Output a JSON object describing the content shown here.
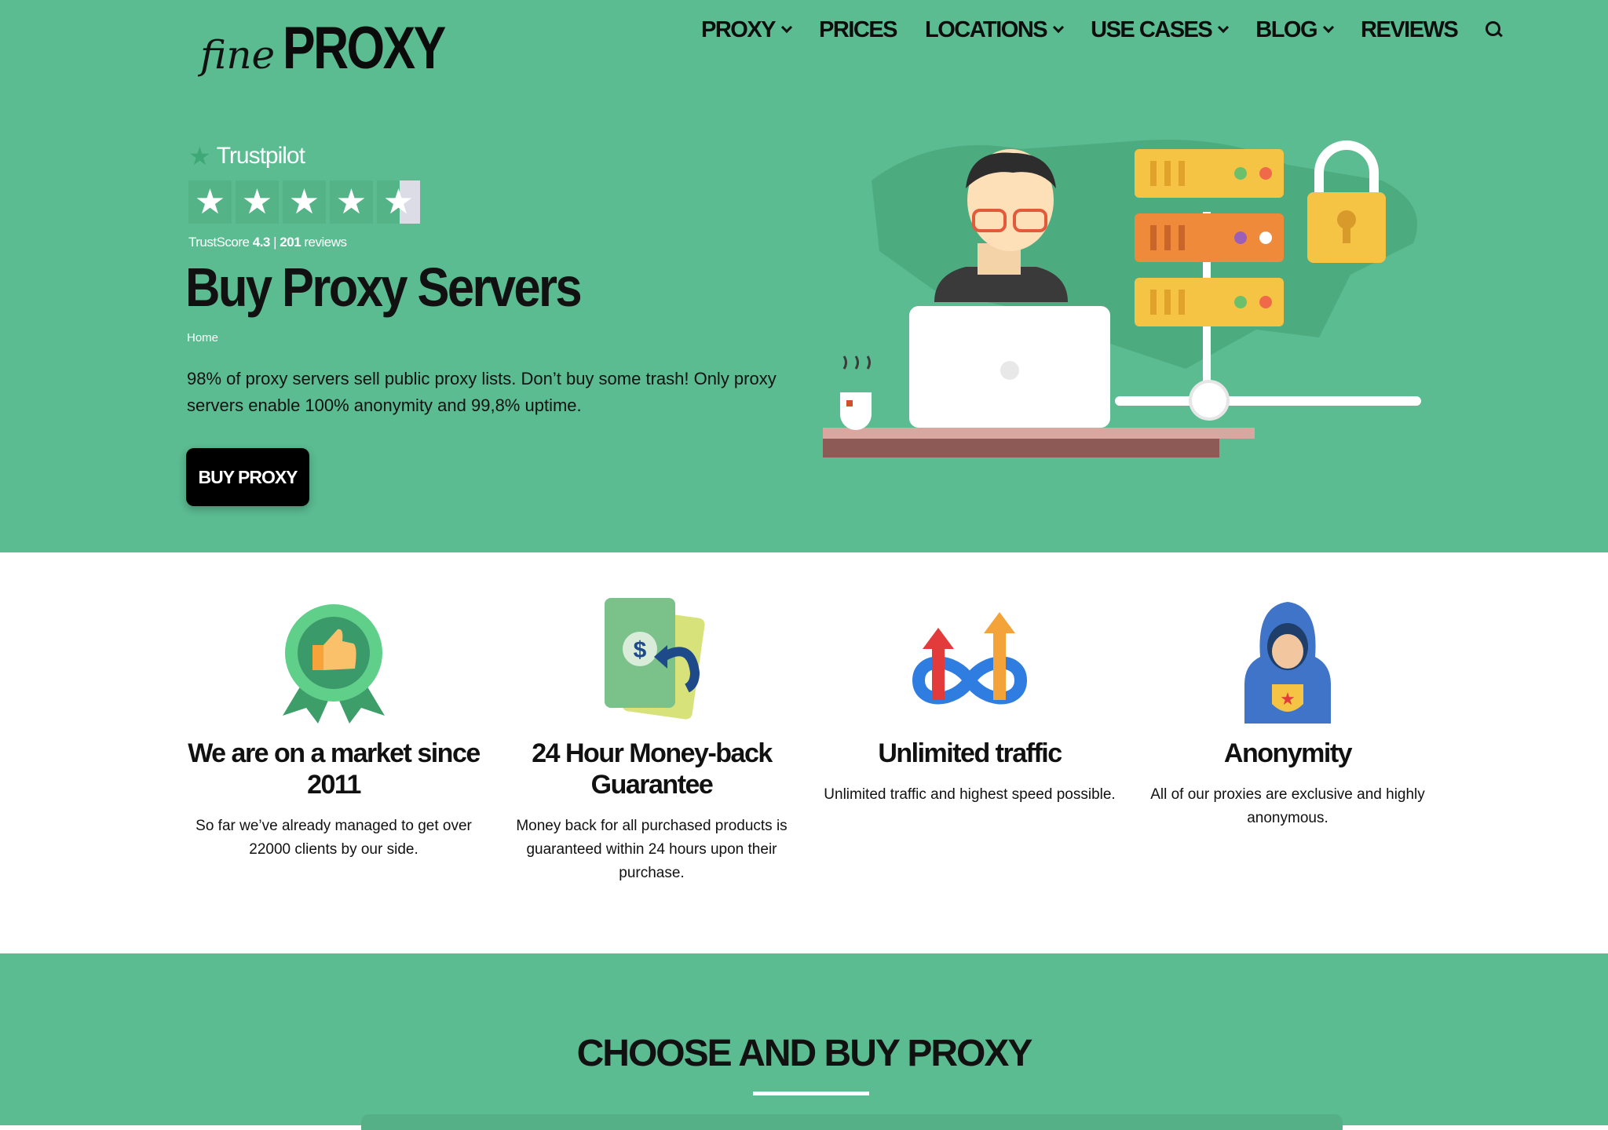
{
  "brand": {
    "fine": "fine",
    "proxy": "PROXY"
  },
  "nav": {
    "items": [
      {
        "label": "PROXY",
        "dropdown": true
      },
      {
        "label": "PRICES",
        "dropdown": false
      },
      {
        "label": "LOCATIONS",
        "dropdown": true
      },
      {
        "label": "USE CASES",
        "dropdown": true
      },
      {
        "label": "BLOG",
        "dropdown": true
      },
      {
        "label": "REVIEWS",
        "dropdown": false
      }
    ],
    "search_icon": "search-icon"
  },
  "trustpilot": {
    "brand": "Trustpilot",
    "score_label": "TrustScore",
    "score": "4.3",
    "separator": "|",
    "reviews_count": "201",
    "reviews_label": "reviews",
    "rating": 4.3
  },
  "hero": {
    "title": "Buy Proxy Servers",
    "breadcrumb": "Home",
    "lead": "98% of proxy servers sell public proxy lists. Don’t buy some trash! Only proxy servers enable 100% anonymity and 99,8% uptime.",
    "cta": "BUY PROXY"
  },
  "features": [
    {
      "icon": "award-thumbs-up-icon",
      "title": "We are on a market since 2011",
      "text": "So far we’ve already managed to get over 22000 clients by our side."
    },
    {
      "icon": "money-back-icon",
      "title": "24 Hour Money-back Guarantee",
      "text": "Money back for all purchased products is guaranteed within 24 hours upon their purchase."
    },
    {
      "icon": "unlimited-traffic-icon",
      "title": "Unlimited traffic",
      "text": "Unlimited traffic and highest speed possible."
    },
    {
      "icon": "anonymous-hood-icon",
      "title": "Anonymity",
      "text": "All of our proxies are exclusive and highly anonymous."
    }
  ],
  "choose": {
    "title": "CHOOSE AND BUY PROXY"
  },
  "colors": {
    "brand_green": "#5bbb91",
    "button": "#000000",
    "text": "#111111"
  }
}
